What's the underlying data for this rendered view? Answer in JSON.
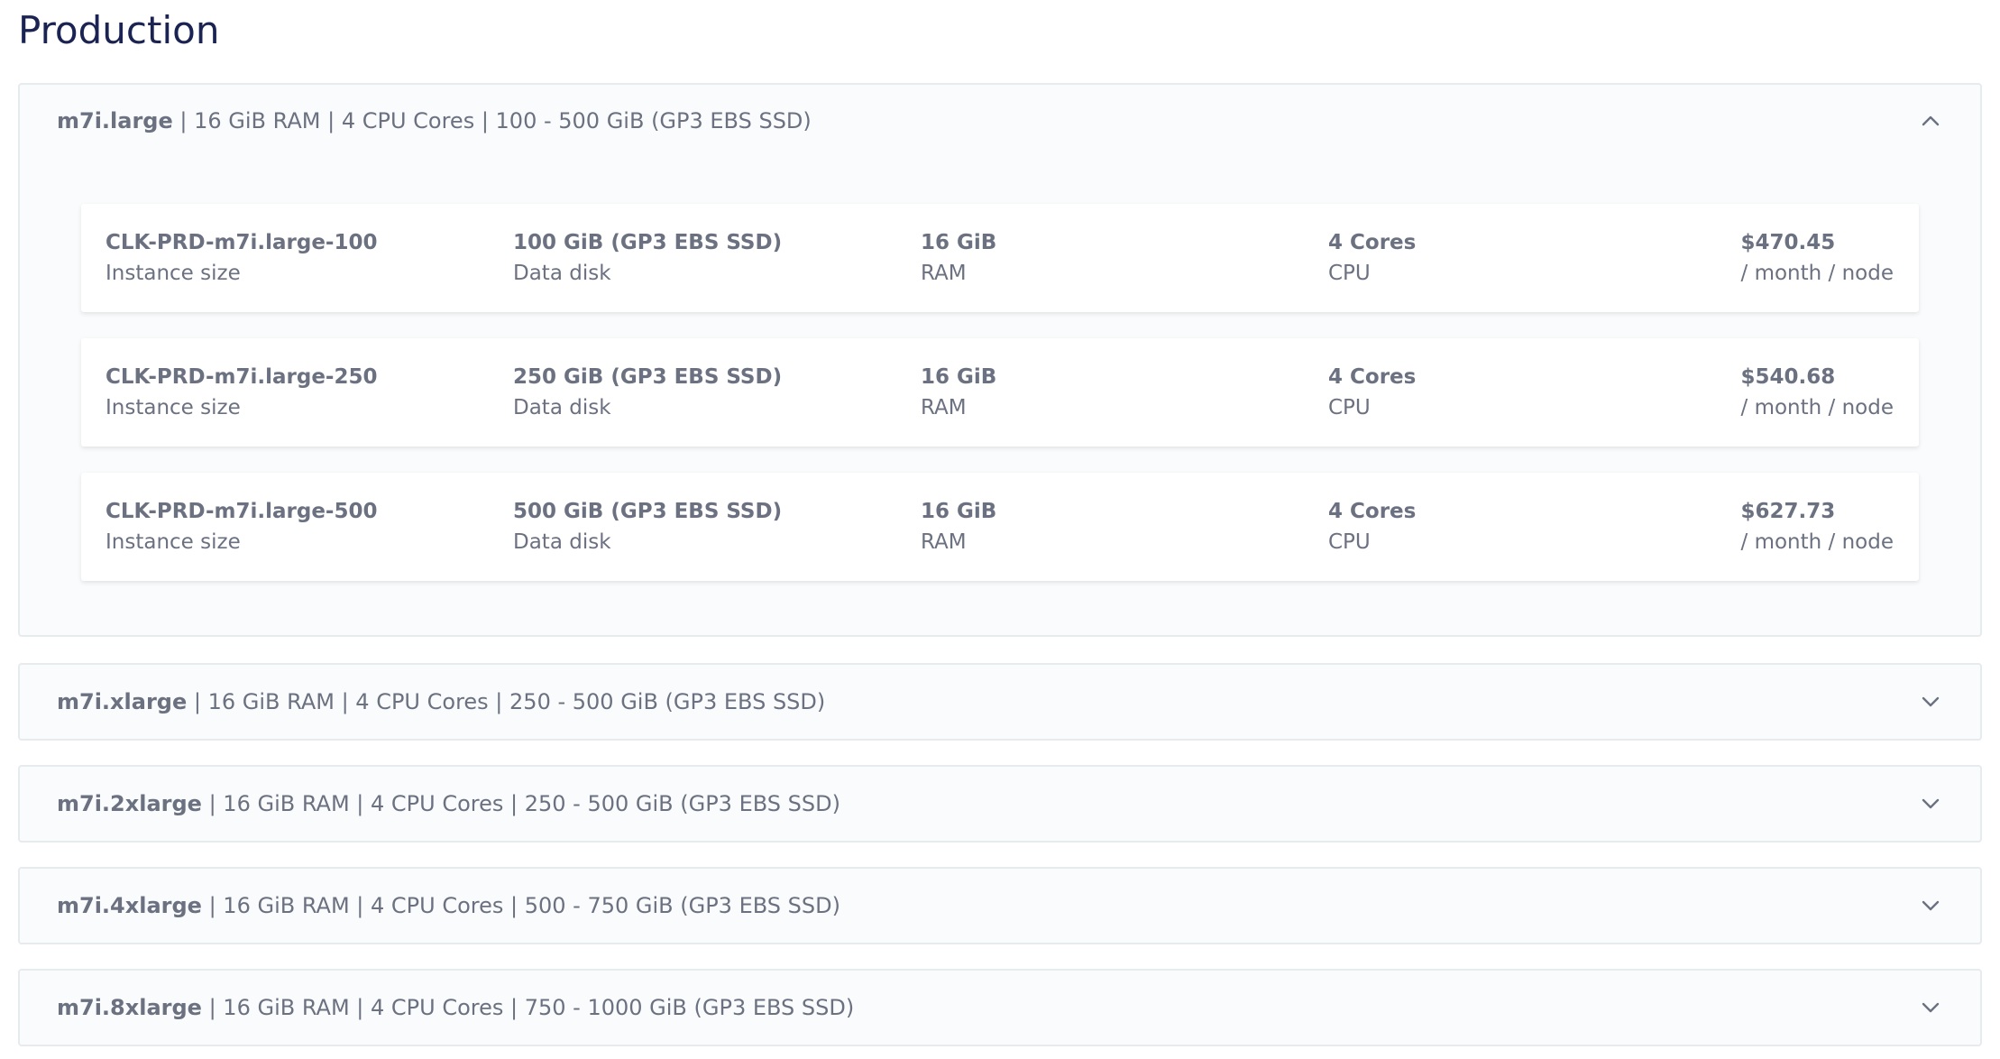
{
  "section_title": "Production",
  "groups": [
    {
      "name": "m7i.large",
      "specs": "| 16 GiB RAM | 4 CPU Cores | 100 - 500 GiB  (GP3 EBS SSD)",
      "expanded": true,
      "chevron": "chevron-up-icon",
      "rows": [
        {
          "instance": "CLK-PRD-m7i.large-100",
          "instance_label": "Instance size",
          "disk": "100 GiB (GP3 EBS SSD)",
          "disk_label": "Data disk",
          "ram": "16 GiB",
          "ram_label": "RAM",
          "cpu": "4 Cores",
          "cpu_label": "CPU",
          "price": "$470.45",
          "price_label": "/ month / node"
        },
        {
          "instance": "CLK-PRD-m7i.large-250",
          "instance_label": "Instance size",
          "disk": "250 GiB (GP3 EBS SSD)",
          "disk_label": "Data disk",
          "ram": "16 GiB",
          "ram_label": "RAM",
          "cpu": "4 Cores",
          "cpu_label": "CPU",
          "price": "$540.68",
          "price_label": "/ month / node"
        },
        {
          "instance": "CLK-PRD-m7i.large-500",
          "instance_label": "Instance size",
          "disk": "500 GiB (GP3 EBS SSD)",
          "disk_label": "Data disk",
          "ram": "16 GiB",
          "ram_label": "RAM",
          "cpu": "4 Cores",
          "cpu_label": "CPU",
          "price": "$627.73",
          "price_label": "/ month / node"
        }
      ]
    },
    {
      "name": "m7i.xlarge",
      "specs": "| 16 GiB RAM | 4 CPU Cores | 250 - 500 GiB  (GP3 EBS SSD)",
      "expanded": false,
      "chevron": "chevron-down-icon"
    },
    {
      "name": "m7i.2xlarge",
      "specs": "| 16 GiB RAM | 4 CPU Cores | 250 - 500 GiB  (GP3 EBS SSD)",
      "expanded": false,
      "chevron": "chevron-down-icon"
    },
    {
      "name": "m7i.4xlarge",
      "specs": "| 16 GiB RAM | 4 CPU Cores | 500 - 750 GiB  (GP3 EBS SSD)",
      "expanded": false,
      "chevron": "chevron-down-icon"
    },
    {
      "name": "m7i.8xlarge",
      "specs": "| 16 GiB RAM | 4 CPU Cores | 750 - 1000 GiB  (GP3 EBS SSD)",
      "expanded": false,
      "chevron": "chevron-down-icon"
    }
  ],
  "colors": {
    "title": "#1a2352",
    "text": "#6b7181",
    "border": "#e6ebee",
    "group_bg": "#fafbfc"
  }
}
